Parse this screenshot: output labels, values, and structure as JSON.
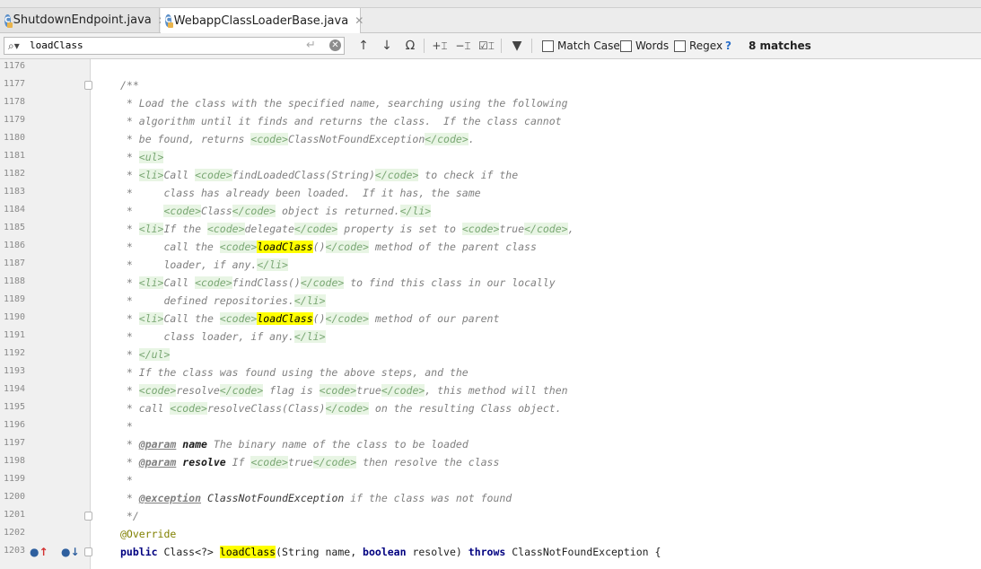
{
  "tabs": [
    {
      "label": "ShutdownEndpoint.java",
      "active": false
    },
    {
      "label": "WebappClassLoaderBase.java",
      "active": true
    }
  ],
  "find": {
    "query": "loadClass",
    "options": [
      "Match Case",
      "Words",
      "Regex"
    ],
    "help": "?",
    "matches": "8 matches"
  },
  "lines": [
    {
      "n": "1176",
      "segs": []
    },
    {
      "n": "1177",
      "segs": [
        [
          "cmt",
          "/**"
        ]
      ],
      "fold": true
    },
    {
      "n": "1178",
      "segs": [
        [
          "cmt",
          " * Load the class with the specified name, searching using the following"
        ]
      ]
    },
    {
      "n": "1179",
      "segs": [
        [
          "cmt",
          " * algorithm until it finds and returns the class.  If the class cannot"
        ]
      ]
    },
    {
      "n": "1180",
      "segs": [
        [
          "cmt",
          " * be found, returns "
        ],
        [
          "tag",
          "<code>"
        ],
        [
          "cmt",
          "ClassNotFoundException"
        ],
        [
          "tag",
          "</code>"
        ],
        [
          "cmt",
          "."
        ]
      ]
    },
    {
      "n": "1181",
      "segs": [
        [
          "cmt",
          " * "
        ],
        [
          "tag",
          "<ul>"
        ]
      ]
    },
    {
      "n": "1182",
      "segs": [
        [
          "cmt",
          " * "
        ],
        [
          "tag",
          "<li>"
        ],
        [
          "cmt",
          "Call "
        ],
        [
          "tag",
          "<code>"
        ],
        [
          "cmt",
          "findLoadedClass(String)"
        ],
        [
          "tag",
          "</code>"
        ],
        [
          "cmt",
          " to check if the"
        ]
      ]
    },
    {
      "n": "1183",
      "segs": [
        [
          "cmt",
          " *     class has already been loaded.  If it has, the same"
        ]
      ]
    },
    {
      "n": "1184",
      "segs": [
        [
          "cmt",
          " *     "
        ],
        [
          "tag",
          "<code>"
        ],
        [
          "cmt",
          "Class"
        ],
        [
          "tag",
          "</code>"
        ],
        [
          "cmt",
          " object is returned."
        ],
        [
          "tag",
          "</li>"
        ]
      ]
    },
    {
      "n": "1185",
      "segs": [
        [
          "cmt",
          " * "
        ],
        [
          "tag",
          "<li>"
        ],
        [
          "cmt",
          "If the "
        ],
        [
          "tag",
          "<code>"
        ],
        [
          "cmt",
          "delegate"
        ],
        [
          "tag",
          "</code>"
        ],
        [
          "cmt",
          " property is set to "
        ],
        [
          "tag",
          "<code>"
        ],
        [
          "cmt",
          "true"
        ],
        [
          "tag",
          "</code>"
        ],
        [
          "cmt",
          ","
        ]
      ]
    },
    {
      "n": "1186",
      "segs": [
        [
          "cmt",
          " *     call the "
        ],
        [
          "tag",
          "<code>"
        ],
        [
          "hl",
          "loadClass"
        ],
        [
          "cmt",
          "()"
        ],
        [
          "tag",
          "</code>"
        ],
        [
          "cmt",
          " method of the parent class"
        ]
      ]
    },
    {
      "n": "1187",
      "segs": [
        [
          "cmt",
          " *     loader, if any."
        ],
        [
          "tag",
          "</li>"
        ]
      ]
    },
    {
      "n": "1188",
      "segs": [
        [
          "cmt",
          " * "
        ],
        [
          "tag",
          "<li>"
        ],
        [
          "cmt",
          "Call "
        ],
        [
          "tag",
          "<code>"
        ],
        [
          "cmt",
          "findClass()"
        ],
        [
          "tag",
          "</code>"
        ],
        [
          "cmt",
          " to find this class in our locally"
        ]
      ]
    },
    {
      "n": "1189",
      "segs": [
        [
          "cmt",
          " *     defined repositories."
        ],
        [
          "tag",
          "</li>"
        ]
      ]
    },
    {
      "n": "1190",
      "segs": [
        [
          "cmt",
          " * "
        ],
        [
          "tag",
          "<li>"
        ],
        [
          "cmt",
          "Call the "
        ],
        [
          "tag",
          "<code>"
        ],
        [
          "hl",
          "loadClass"
        ],
        [
          "cmt",
          "()"
        ],
        [
          "tag",
          "</code>"
        ],
        [
          "cmt",
          " method of our parent"
        ]
      ]
    },
    {
      "n": "1191",
      "segs": [
        [
          "cmt",
          " *     class loader, if any."
        ],
        [
          "tag",
          "</li>"
        ]
      ]
    },
    {
      "n": "1192",
      "segs": [
        [
          "cmt",
          " * "
        ],
        [
          "tag",
          "</ul>"
        ]
      ]
    },
    {
      "n": "1193",
      "segs": [
        [
          "cmt",
          " * If the class was found using the above steps, and the"
        ]
      ]
    },
    {
      "n": "1194",
      "segs": [
        [
          "cmt",
          " * "
        ],
        [
          "tag",
          "<code>"
        ],
        [
          "cmt",
          "resolve"
        ],
        [
          "tag",
          "</code>"
        ],
        [
          "cmt",
          " flag is "
        ],
        [
          "tag",
          "<code>"
        ],
        [
          "cmt",
          "true"
        ],
        [
          "tag",
          "</code>"
        ],
        [
          "cmt",
          ", this method will then"
        ]
      ]
    },
    {
      "n": "1195",
      "segs": [
        [
          "cmt",
          " * call "
        ],
        [
          "tag",
          "<code>"
        ],
        [
          "cmt",
          "resolveClass(Class)"
        ],
        [
          "tag",
          "</code>"
        ],
        [
          "cmt",
          " on the resulting Class object."
        ]
      ]
    },
    {
      "n": "1196",
      "segs": [
        [
          "cmt",
          " *"
        ]
      ]
    },
    {
      "n": "1197",
      "segs": [
        [
          "cmt",
          " * "
        ],
        [
          "doctag",
          "@param"
        ],
        [
          "cmt",
          " "
        ],
        [
          "docparam",
          "name"
        ],
        [
          "cmt",
          " The binary name of the class to be loaded"
        ]
      ]
    },
    {
      "n": "1198",
      "segs": [
        [
          "cmt",
          " * "
        ],
        [
          "doctag",
          "@param"
        ],
        [
          "cmt",
          " "
        ],
        [
          "docparam",
          "resolve"
        ],
        [
          "cmt",
          " If "
        ],
        [
          "tag",
          "<code>"
        ],
        [
          "cmt",
          "true"
        ],
        [
          "tag",
          "</code>"
        ],
        [
          "cmt",
          " then resolve the class"
        ]
      ]
    },
    {
      "n": "1199",
      "segs": [
        [
          "cmt",
          " *"
        ]
      ]
    },
    {
      "n": "1200",
      "segs": [
        [
          "cmt",
          " * "
        ],
        [
          "doctag",
          "@exception"
        ],
        [
          "cmt",
          " "
        ],
        [
          "docref",
          "ClassNotFoundException"
        ],
        [
          "cmt",
          " if the class was not found"
        ]
      ]
    },
    {
      "n": "1201",
      "segs": [
        [
          "cmt",
          " */"
        ]
      ],
      "fold": true
    },
    {
      "n": "1202",
      "segs": [
        [
          "ann",
          "@Override"
        ]
      ]
    },
    {
      "n": "1203",
      "segs": [
        [
          "kw",
          "public"
        ],
        [
          "plain",
          " Class<?> "
        ],
        [
          "hlc",
          "loadClass"
        ],
        [
          "plain",
          "(String name, "
        ],
        [
          "kw",
          "boolean"
        ],
        [
          "plain",
          " resolve) "
        ],
        [
          "kw",
          "throws"
        ],
        [
          "plain",
          " ClassNotFoundException {"
        ]
      ],
      "fold": true,
      "markers": true
    }
  ]
}
